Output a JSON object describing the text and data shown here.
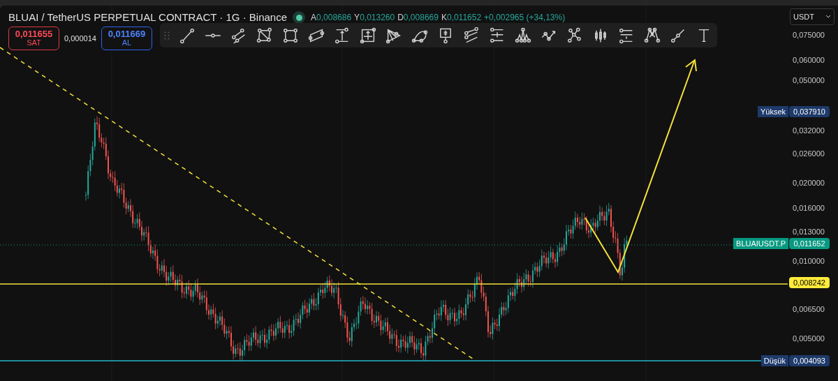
{
  "header": {
    "title": "BLUAI / TetherUS PERPETUAL CONTRACT · 1G · Binance",
    "market_open": true,
    "ohlc": [
      {
        "key": "A",
        "value": "0,008686"
      },
      {
        "key": "Y",
        "value": "0,013260"
      },
      {
        "key": "D",
        "value": "0,008669"
      },
      {
        "key": "K",
        "value": "0,011652"
      }
    ],
    "change": "+0,002965 (+34,13%)"
  },
  "trade": {
    "sell": {
      "price": "0,011655",
      "label": "SAT"
    },
    "spread": "0,000014",
    "buy": {
      "price": "0,011669",
      "label": "AL"
    }
  },
  "toolbar": {
    "tools": [
      {
        "kind": "trend-line"
      },
      {
        "kind": "horizontal-ray"
      },
      {
        "kind": "parallel"
      },
      {
        "kind": "xabcd"
      },
      {
        "kind": "rectangle"
      },
      {
        "kind": "parallelogram"
      },
      {
        "kind": "measure"
      },
      {
        "kind": "crosshair-box"
      },
      {
        "kind": "pitchfork"
      },
      {
        "kind": "arc"
      },
      {
        "kind": "price-note"
      },
      {
        "kind": "channel"
      },
      {
        "kind": "long-position"
      },
      {
        "kind": "head-shoulders"
      },
      {
        "kind": "path"
      },
      {
        "kind": "network"
      },
      {
        "kind": "candles"
      },
      {
        "kind": "short-position"
      },
      {
        "kind": "pattern"
      },
      {
        "kind": "segment"
      },
      {
        "kind": "text-tool"
      }
    ]
  },
  "currency": "USDT",
  "price_axis": [
    "0,075000",
    "0,060000",
    "0,050000",
    "0,032000",
    "0,026000",
    "0,020000",
    "0,016000",
    "0,013000",
    "0,010000",
    "0,006500",
    "0,005000"
  ],
  "price_labels": [
    {
      "kind": "high",
      "label": "Yüksek",
      "value": "0,037910",
      "color": "#1e3a6b"
    },
    {
      "kind": "symbol",
      "label": "BLUAIUSDT.P",
      "value": "0,011652",
      "color": "#089981"
    },
    {
      "kind": "line",
      "value": "0,008242",
      "color": "#ffeb3b"
    },
    {
      "kind": "low",
      "label": "Düşük",
      "value": "0,004093",
      "color": "#1e3a6b"
    }
  ]
}
